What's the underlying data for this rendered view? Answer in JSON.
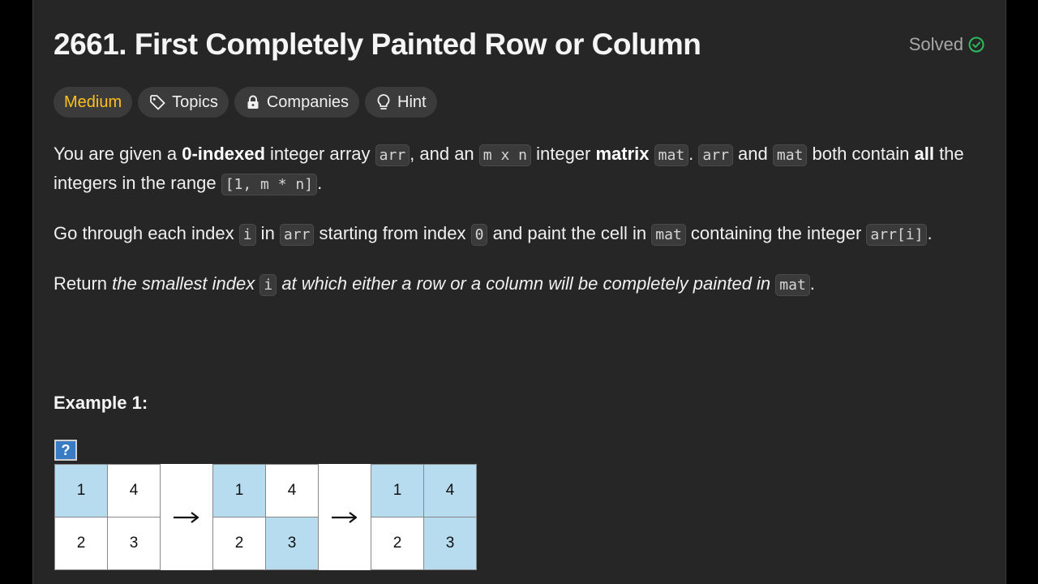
{
  "problem": {
    "title": "2661. First Completely Painted Row or Column",
    "status": "Solved"
  },
  "tags": {
    "difficulty": "Medium",
    "topics": "Topics",
    "companies": "Companies",
    "hint": "Hint"
  },
  "description": {
    "p1": [
      {
        "t": "text",
        "v": "You are given a "
      },
      {
        "t": "bold",
        "v": "0-indexed"
      },
      {
        "t": "text",
        "v": " integer array "
      },
      {
        "t": "code",
        "v": "arr"
      },
      {
        "t": "text",
        "v": ", and an "
      },
      {
        "t": "code",
        "v": "m x n"
      },
      {
        "t": "text",
        "v": " integer "
      },
      {
        "t": "bold",
        "v": "matrix"
      },
      {
        "t": "text",
        "v": " "
      },
      {
        "t": "code",
        "v": "mat"
      },
      {
        "t": "text",
        "v": ". "
      },
      {
        "t": "code",
        "v": "arr"
      },
      {
        "t": "text",
        "v": " and "
      },
      {
        "t": "code",
        "v": "mat"
      },
      {
        "t": "text",
        "v": " both contain "
      },
      {
        "t": "bold",
        "v": "all"
      },
      {
        "t": "text",
        "v": " the integers in the range "
      },
      {
        "t": "code",
        "v": "[1, m * n]"
      },
      {
        "t": "text",
        "v": "."
      }
    ],
    "p2": [
      {
        "t": "text",
        "v": "Go through each index "
      },
      {
        "t": "code",
        "v": "i"
      },
      {
        "t": "text",
        "v": " in "
      },
      {
        "t": "code",
        "v": "arr"
      },
      {
        "t": "text",
        "v": " starting from index "
      },
      {
        "t": "code",
        "v": "0"
      },
      {
        "t": "text",
        "v": " and paint the cell in "
      },
      {
        "t": "code",
        "v": "mat"
      },
      {
        "t": "text",
        "v": " containing the integer "
      },
      {
        "t": "code",
        "v": "arr[i]"
      },
      {
        "t": "text",
        "v": "."
      }
    ],
    "p3": [
      {
        "t": "text",
        "v": "Return "
      },
      {
        "t": "italic",
        "v": "the smallest index "
      },
      {
        "t": "code",
        "v": "i"
      },
      {
        "t": "italic",
        "v": " at which either a row or a column will be completely painted in "
      },
      {
        "t": "code",
        "v": "mat"
      },
      {
        "t": "text",
        "v": "."
      }
    ]
  },
  "example": {
    "title": "Example 1:",
    "broken_image_glyph": "?",
    "arrow": "→",
    "grids": [
      {
        "cells": [
          {
            "v": "1",
            "painted": true
          },
          {
            "v": "4",
            "painted": false
          },
          {
            "v": "2",
            "painted": false
          },
          {
            "v": "3",
            "painted": false
          }
        ]
      },
      {
        "cells": [
          {
            "v": "1",
            "painted": true
          },
          {
            "v": "4",
            "painted": false
          },
          {
            "v": "2",
            "painted": false
          },
          {
            "v": "3",
            "painted": true
          }
        ]
      },
      {
        "cells": [
          {
            "v": "1",
            "painted": true
          },
          {
            "v": "4",
            "painted": true
          },
          {
            "v": "2",
            "painted": false
          },
          {
            "v": "3",
            "painted": true
          }
        ]
      }
    ]
  },
  "colors": {
    "background": "#262626",
    "difficulty_medium": "#ffc01e",
    "solved_check": "#2cbb5d",
    "painted_cell": "#b7dcf0"
  }
}
